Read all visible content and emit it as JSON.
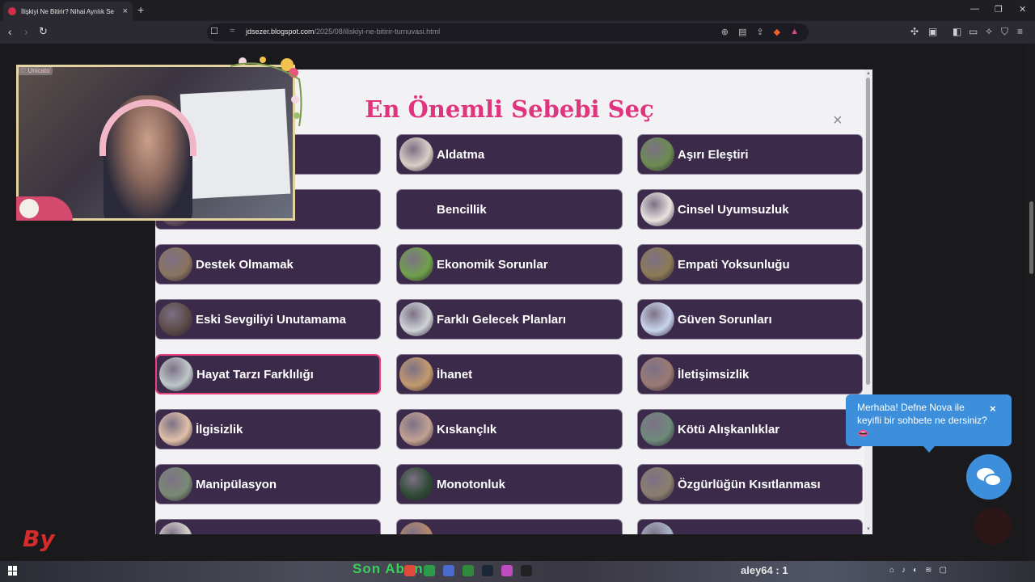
{
  "browser": {
    "tab_title": "İlişkiyi Ne Bitirir? Nihai Ayrılık Se",
    "tab_close": "×",
    "new_tab": "+",
    "url_host": "jdsezer.blogspot.com",
    "url_path": "/2025/08/iliskiyi-ne-bitirir-turnuvasi.html"
  },
  "modal": {
    "title": "En Önemli Sebebi Seç",
    "close": "×",
    "options": [
      {
        "label": "",
        "color": "#8a6f7a"
      },
      {
        "label": "Aldatma",
        "color": "#d9cfc6"
      },
      {
        "label": "Aşırı Eleştiri",
        "color": "#6b8c4f"
      },
      {
        "label": "",
        "color": "#6a5060"
      },
      {
        "label": "Bencillik",
        "color": "#3b2a49"
      },
      {
        "label": "Cinsel Uyumsuzluk",
        "color": "#e7e2de"
      },
      {
        "label": "Destek Olmamak",
        "color": "#8a7460"
      },
      {
        "label": "Ekonomik Sorunlar",
        "color": "#6fa14a"
      },
      {
        "label": "Empati Yoksunluğu",
        "color": "#8c7a55"
      },
      {
        "label": "Eski Sevgiliyi Unutamama",
        "color": "#5b4a46"
      },
      {
        "label": "Farklı Gelecek Planları",
        "color": "#cfd3d6"
      },
      {
        "label": "Güven Sorunları",
        "color": "#c9d5ef"
      },
      {
        "label": "Hayat Tarzı Farklılığı",
        "color": "#bfc7c9"
      },
      {
        "label": "İhanet",
        "color": "#c39a6e"
      },
      {
        "label": "İletişimsizlik",
        "color": "#9a7a74"
      },
      {
        "label": "İlgisizlik",
        "color": "#e0c0a8"
      },
      {
        "label": "Kıskançlık",
        "color": "#c2a192"
      },
      {
        "label": "Kötü Alışkanlıklar",
        "color": "#6e8a7a"
      },
      {
        "label": "Manipülasyon",
        "color": "#7a8a74"
      },
      {
        "label": "Monotonluk",
        "color": "#2e4a34"
      },
      {
        "label": "Özgürlüğün Kısıtlanması",
        "color": "#8a7e6e"
      },
      {
        "label": "",
        "color": "#d5d0cc"
      },
      {
        "label": "",
        "color": "#b5886a"
      },
      {
        "label": "",
        "color": "#a8b4c5"
      }
    ]
  },
  "stream": {
    "cam_tag": "♡ Unicato",
    "by_logo": "By"
  },
  "chat": {
    "message": "Merhaba! Defne Nova ile keyifli bir sohbete ne dersiniz? 👄",
    "close": "×"
  },
  "taskbar": {
    "ticker": "Son Abone: ",
    "user": "aley64 : 1"
  }
}
